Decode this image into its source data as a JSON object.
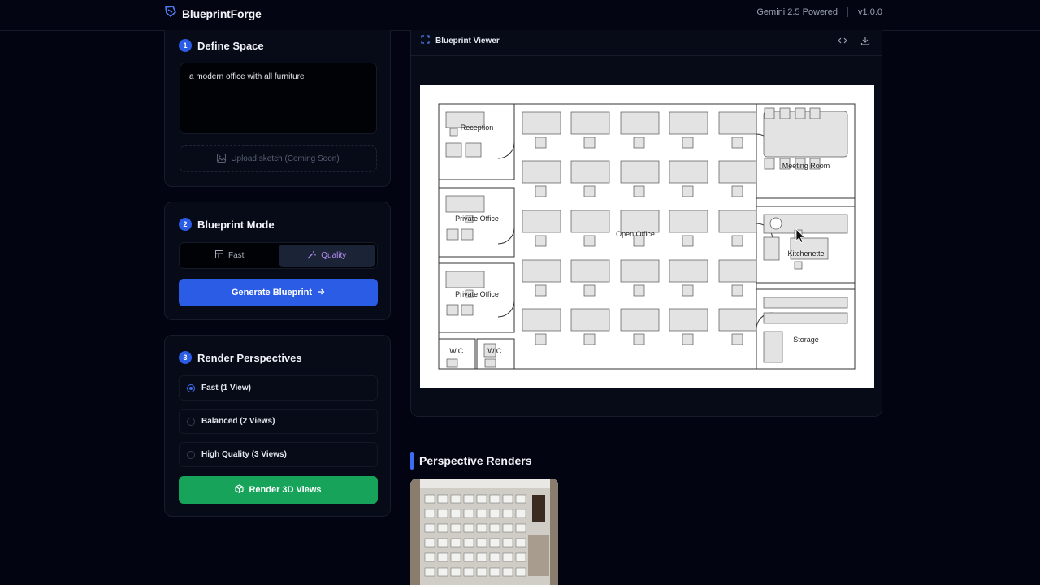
{
  "app": {
    "name": "BlueprintForge",
    "powered": "Gemini 2.5 Powered",
    "version": "v1.0.0"
  },
  "define_space": {
    "step": "1",
    "title": "Define Space",
    "prompt_value": "a modern office  with all furniture",
    "upload_label": "Upload sketch (Coming Soon)"
  },
  "blueprint_mode": {
    "step": "2",
    "title": "Blueprint Mode",
    "fast_label": "Fast",
    "quality_label": "Quality",
    "generate_label": "Generate Blueprint"
  },
  "render_perspectives": {
    "step": "3",
    "title": "Render Perspectives",
    "options": [
      {
        "label": "Fast (1 View)",
        "selected": true
      },
      {
        "label": "Balanced (2 Views)",
        "selected": false
      },
      {
        "label": "High Quality (3 Views)",
        "selected": false
      }
    ],
    "render_label": "Render 3D Views"
  },
  "viewer": {
    "title": "Blueprint Viewer",
    "rooms": {
      "reception": "Reception",
      "private_office_1": "Private Office",
      "private_office_2": "Private Office",
      "wc_1": "W.C.",
      "wc_2": "W.C.",
      "open_office": "Open Office",
      "meeting_room": "Meeting Room",
      "kitchenette": "Kitchenette",
      "storage": "Storage"
    }
  },
  "perspective_renders": {
    "title": "Perspective Renders"
  },
  "colors": {
    "accent_blue": "#2b5ce6",
    "accent_green": "#17a45a",
    "accent_purple": "#b68cf0"
  }
}
